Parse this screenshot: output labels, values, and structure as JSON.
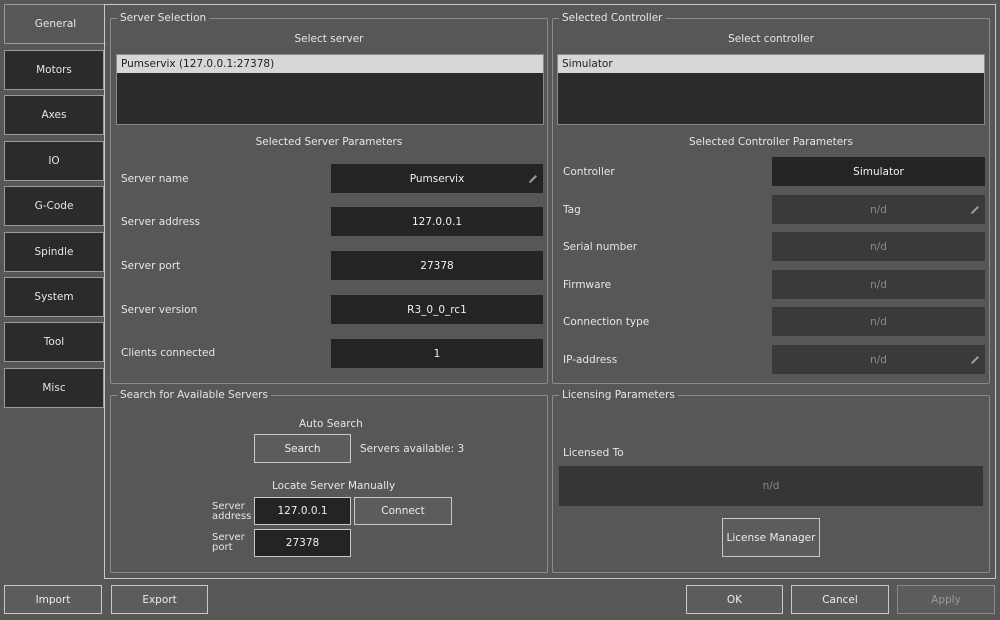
{
  "tabs": [
    "General",
    "Motors",
    "Axes",
    "IO",
    "G-Code",
    "Spindle",
    "System",
    "Tool",
    "Misc"
  ],
  "server_selection": {
    "title": "Server Selection",
    "select_label": "Select server",
    "servers": [
      "Pumservix (127.0.0.1:27378)"
    ],
    "params_title": "Selected Server Parameters",
    "params": [
      {
        "label": "Server name",
        "value": "Pumservix"
      },
      {
        "label": "Server address",
        "value": "127.0.0.1"
      },
      {
        "label": "Server port",
        "value": "27378"
      },
      {
        "label": "Server version",
        "value": "R3_0_0_rc1"
      },
      {
        "label": "Clients connected",
        "value": "1"
      }
    ]
  },
  "selected_controller": {
    "title": "Selected Controller",
    "select_label": "Select controller",
    "controllers": [
      "Simulator"
    ],
    "params_title": "Selected Controller Parameters",
    "params": [
      {
        "label": "Controller",
        "value": "Simulator"
      },
      {
        "label": "Tag",
        "value": "n/d"
      },
      {
        "label": "Serial number",
        "value": "n/d"
      },
      {
        "label": "Firmware",
        "value": "n/d"
      },
      {
        "label": "Connection type",
        "value": "n/d"
      },
      {
        "label": "IP-address",
        "value": "n/d"
      }
    ]
  },
  "search": {
    "title": "Search for Available Servers",
    "auto_label": "Auto Search",
    "search_button": "Search",
    "servers_available": "Servers available: 3",
    "manual_label": "Locate Server Manually",
    "address_label_1": "Server",
    "address_label_2": "address",
    "address_value": "127.0.0.1",
    "connect_button": "Connect",
    "port_label_1": "Server",
    "port_label_2": "port",
    "port_value": "27378"
  },
  "licensing": {
    "title": "Licensing Parameters",
    "licensed_to_label": "Licensed To",
    "licensed_to_value": "n/d",
    "manager_button": "License Manager"
  },
  "footer": {
    "import": "Import",
    "export": "Export",
    "ok": "OK",
    "cancel": "Cancel",
    "apply": "Apply"
  }
}
